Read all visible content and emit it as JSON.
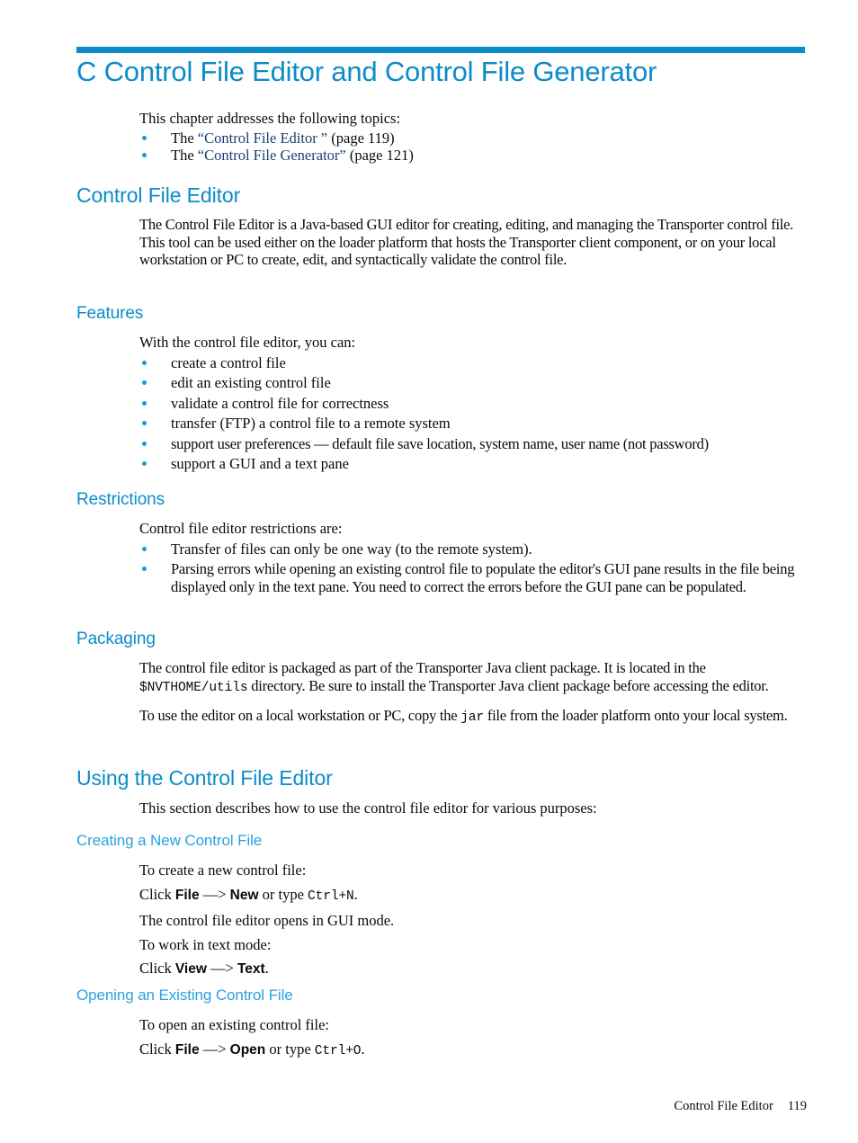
{
  "chapter": {
    "number_and_title": "C Control File Editor and Control File Generator",
    "intro": "This chapter addresses the following topics:",
    "topics": [
      {
        "prefix": "The ",
        "link": "“Control File Editor ”",
        "suffix": " (page 119)"
      },
      {
        "prefix": "The ",
        "link": "“Control File Generator”",
        "suffix": " (page 121)"
      }
    ]
  },
  "sections": {
    "control_file_editor": {
      "heading": "Control File Editor",
      "paragraph": "The Control File Editor is a Java-based GUI editor for creating, editing, and managing the Transporter control file. This tool can be used either on the loader platform that hosts the Transporter client component, or on your local workstation or PC to create, edit, and syntactically validate the control file."
    },
    "features": {
      "heading": "Features",
      "lead": "With the control file editor, you can:",
      "items": [
        "create a control file",
        "edit an existing control file",
        "validate a control file for correctness",
        "transfer (FTP) a control file to a remote system",
        "support user preferences — default file save location, system name, user name (not password)",
        "support a GUI and a text pane"
      ]
    },
    "restrictions": {
      "heading": "Restrictions",
      "lead": "Control file editor restrictions are:",
      "items": [
        "Transfer of files can only be one way (to the remote system).",
        "Parsing errors while opening an existing control file to populate the editor's GUI pane results in the file being displayed only in the text pane. You need to correct the errors before the GUI pane can be populated."
      ]
    },
    "packaging": {
      "heading": "Packaging",
      "paragraph1_part1": "The control file editor is packaged as part of the Transporter Java client package. It is located in the ",
      "paragraph1_code": "$NVTHOME/utils",
      "paragraph1_part2": " directory. Be sure to install the Transporter Java client package before accessing the editor.",
      "paragraph2_part1": "To use the editor on a local workstation or PC, copy the ",
      "paragraph2_code": "jar",
      "paragraph2_part2": " file from the loader platform onto your local system."
    },
    "using_editor": {
      "heading": "Using the Control File Editor",
      "paragraph": "This section describes how to use the control file editor for various purposes:"
    },
    "creating_new": {
      "heading": "Creating a New Control File",
      "line1": "To create a new control file:",
      "click2_prefix": "Click ",
      "click2_menu": "File",
      "click2_arrow": " —> ",
      "click2_item": "New",
      "click2_mid": " or type ",
      "click2_code": "Ctrl+N",
      "click2_suffix": ".",
      "line3": "The control file editor opens in GUI mode.",
      "line4": "To work in text mode:",
      "click5_prefix": "Click ",
      "click5_menu": "View",
      "click5_arrow": " —> ",
      "click5_item": "Text",
      "click5_suffix": "."
    },
    "opening_existing": {
      "heading": "Opening an Existing Control File",
      "line1": "To open an existing control file:",
      "click2_prefix": "Click ",
      "click2_menu": "File",
      "click2_arrow": " —> ",
      "click2_item": "Open",
      "click2_mid": " or type ",
      "click2_code": "Ctrl+O",
      "click2_suffix": "."
    }
  },
  "footer": {
    "running_head": "Control File Editor",
    "page_number": "119"
  },
  "colors": {
    "accent_blue": "#0b8cc8",
    "light_blue": "#2aa3de",
    "bullet_blue": "#1a9bd7",
    "xref_navy": "#1b3f72"
  }
}
